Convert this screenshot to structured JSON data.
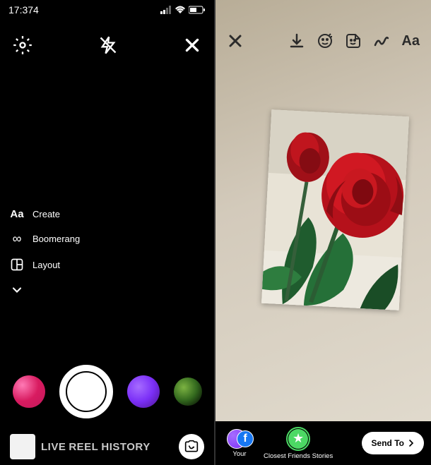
{
  "left": {
    "status": {
      "time": "17:374"
    },
    "modes": {
      "create": {
        "icon": "Aa",
        "label": "Create"
      },
      "boomerang": {
        "label": "Boomerang"
      },
      "layout": {
        "label": "Layout"
      }
    },
    "bottom_tabs": {
      "live": "LIVE",
      "reel": "REEL",
      "history": "HISTORY"
    }
  },
  "right": {
    "toolbar": {
      "text_tool": "Aa"
    },
    "share": {
      "your_story": "Your",
      "close_friends_line1": "Closest Friends",
      "close_friends_line2": "Stories",
      "send_to": "Send To"
    }
  }
}
